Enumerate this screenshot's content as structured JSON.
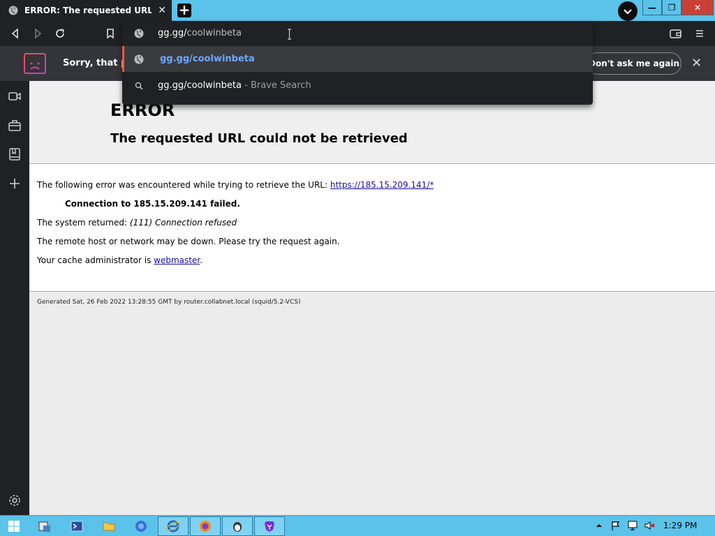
{
  "tab": {
    "title": "ERROR: The requested URL could not be retrieved",
    "close": "✕"
  },
  "newtab": "+",
  "window": {
    "minimize": "—",
    "maximize": "❐",
    "close": "✕"
  },
  "omnibox": {
    "typed": "gg.gg/",
    "typed_rest": "coolwinbeta",
    "suggestions": [
      {
        "label": "gg.gg/coolwinbeta",
        "sub": ""
      },
      {
        "label": "gg.gg/coolwinbeta",
        "sub": " - Brave Search"
      }
    ]
  },
  "infobar": {
    "text": "Sorry, that page",
    "dont_ask": "Don't ask me again",
    "close": "✕"
  },
  "error": {
    "title": "ERROR",
    "subtitle": "The requested URL could not be retrieved",
    "line1": "The following error was encountered while trying to retrieve the URL: ",
    "url": "https://185.15.209.141/*",
    "connection": "Connection to 185.15.209.141 failed.",
    "system_prefix": "The system returned: ",
    "system_value": "(111) Connection refused",
    "remote": "The remote host or network may be down. Please try the request again.",
    "cache_prefix": "Your cache administrator is ",
    "cache_link": "webmaster",
    "cache_suffix": ".",
    "footer": "Generated Sat, 26 Feb 2022 13:28:55 GMT by router.collabnet.local (squid/5.2-VCS)"
  },
  "clock": "1:29 PM",
  "colors": {
    "tabstrip": "#5bc3ea",
    "browser_dark": "#202124",
    "link": "#1a0dab",
    "accent_suggestion": "#6ea8ff"
  }
}
